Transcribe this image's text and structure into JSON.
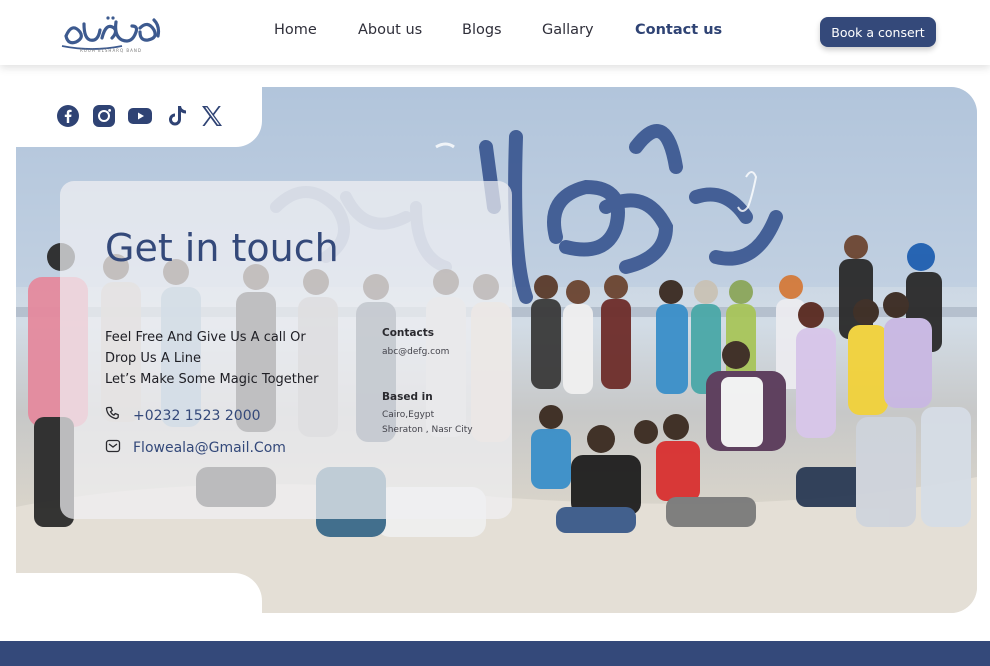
{
  "header": {
    "logo_sub": "ROUH ELSHARQ BAND",
    "nav": [
      {
        "label": "Home",
        "active": false
      },
      {
        "label": "About us",
        "active": false
      },
      {
        "label": "Blogs",
        "active": false
      },
      {
        "label": "Gallary",
        "active": false
      },
      {
        "label": "Contact us",
        "active": true
      }
    ],
    "cta": "Book a consert"
  },
  "social": [
    "facebook-icon",
    "instagram-icon",
    "youtube-icon",
    "tiktok-icon",
    "x-icon"
  ],
  "contact_card": {
    "title": "Get in touch",
    "tagline": [
      "Feel Free And Give Us A call Or",
      "Drop Us A Line",
      "Let’s Make Some Magic Together"
    ],
    "phone": "+0232 1523 2000",
    "email": "Floweala@Gmail.Com",
    "contacts_heading": "Contacts",
    "contacts_value": "abc@defg.com",
    "based_heading": "Based in",
    "based_lines": [
      "Cairo,Egypt",
      "Sheraton , Nasr City"
    ]
  },
  "colors": {
    "primary": "#34497a",
    "text": "#1e1e24",
    "footer": "#34497a"
  }
}
